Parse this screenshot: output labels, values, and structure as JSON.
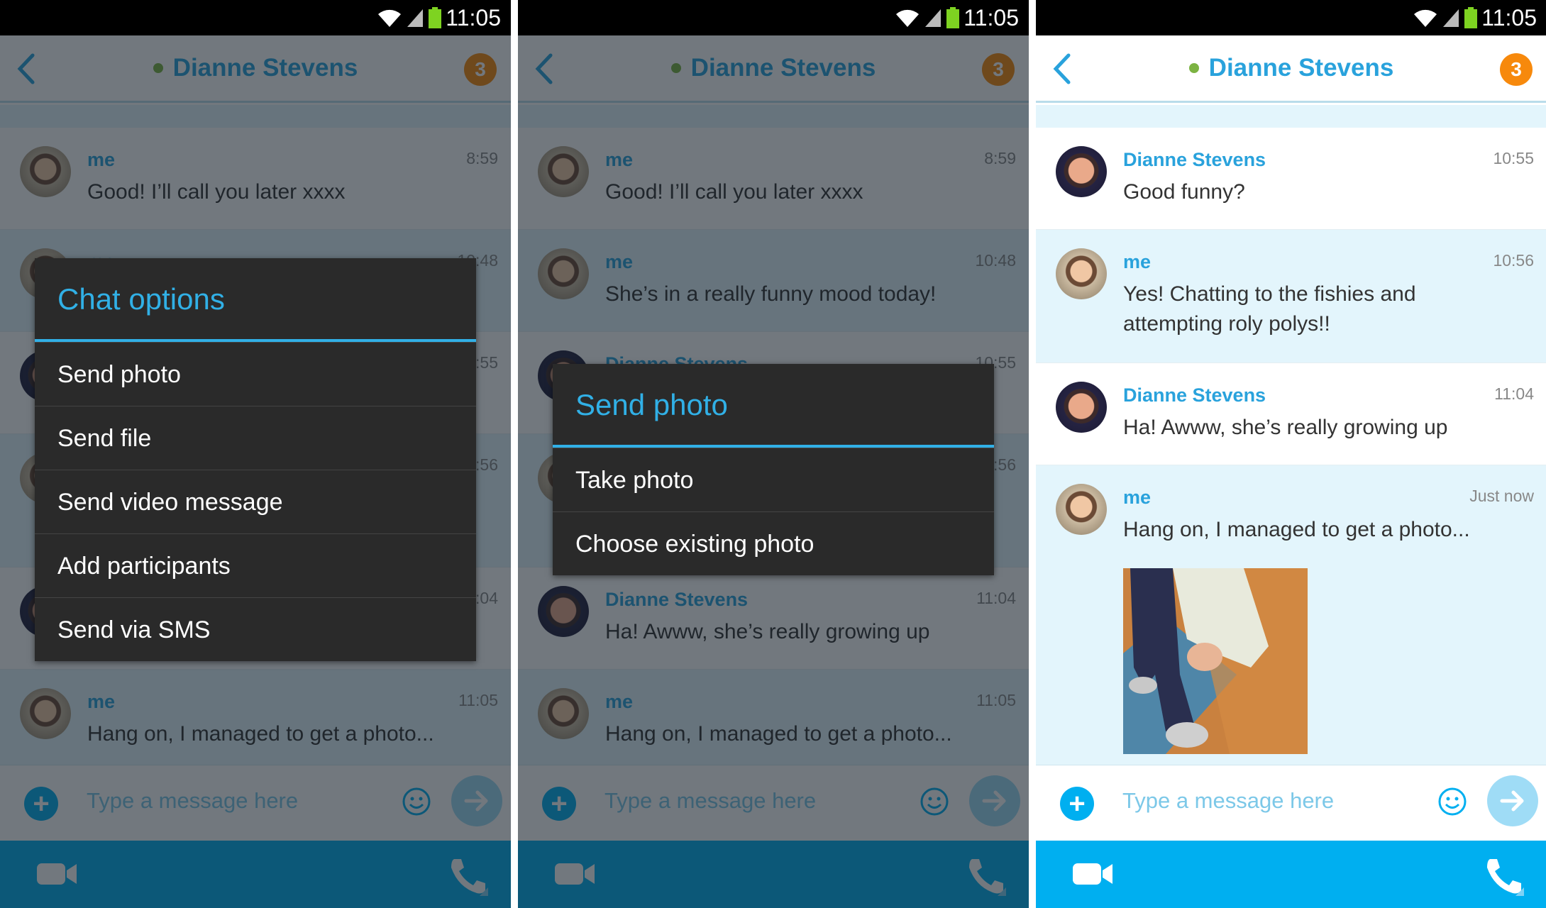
{
  "status_bar": {
    "time": "11:05",
    "icons": [
      "wifi-icon",
      "signal-icon",
      "battery-icon"
    ]
  },
  "colors": {
    "accent": "#29a2dc",
    "badge": "#f7890c",
    "presence": "#7cb342",
    "bar": "#00aff0",
    "dialog": "#2a2a2a"
  },
  "panels": [
    {
      "header": {
        "title": "Dianne Stevens",
        "badge": "3"
      },
      "dimmed": true,
      "messages": [
        {
          "sender": "me",
          "time": "8:59",
          "text": "Good! I’ll call you later xxxx",
          "avatar": "me"
        },
        {
          "sender": "me",
          "time": "10:48",
          "text": "She’s in a really funny mood today!",
          "avatar": "me",
          "alt": true
        },
        {
          "sender": "Dianne Stevens",
          "time": "10:55",
          "text": "Good funny?",
          "avatar": "dianne"
        },
        {
          "sender": "me",
          "time": "10:56",
          "text": "Yes! Chatting to the fishies and attempt-ing roly polys!!",
          "avatar": "me",
          "alt": true,
          "tall": true
        },
        {
          "sender": "Dianne Stevens",
          "time": "11:04",
          "text": "Ha! Awww, she’s really growing up",
          "avatar": "dianne"
        },
        {
          "sender": "me",
          "time": "11:05",
          "text": "Hang on, I managed to get a photo...",
          "avatar": "me",
          "alt": true
        }
      ],
      "dialog": {
        "title": "Chat options",
        "items": [
          "Send photo",
          "Send file",
          "Send video message",
          "Add participants",
          "Send via SMS"
        ]
      },
      "input": {
        "placeholder": "Type a message here"
      }
    },
    {
      "header": {
        "title": "Dianne Stevens",
        "badge": "3"
      },
      "dimmed": true,
      "messages": [
        {
          "sender": "me",
          "time": "8:59",
          "text": "Good! I’ll call you later xxxx",
          "avatar": "me"
        },
        {
          "sender": "me",
          "time": "10:48",
          "text": "She’s in a really funny mood today!",
          "avatar": "me",
          "alt": true
        },
        {
          "sender": "Dianne Stevens",
          "time": "10:55",
          "text": "Good funny?",
          "avatar": "dianne"
        },
        {
          "sender": "me",
          "time": "10:56",
          "text": "Yes! Chatting to the fishies and attempt-ing roly polys!!",
          "avatar": "me",
          "alt": true,
          "tall": true
        },
        {
          "sender": "Dianne Stevens",
          "time": "11:04",
          "text": "Ha! Awww, she’s really growing up",
          "avatar": "dianne"
        },
        {
          "sender": "me",
          "time": "11:05",
          "text": "Hang on, I managed to get a photo...",
          "avatar": "me",
          "alt": true
        }
      ],
      "dialog": {
        "title": "Send photo",
        "items": [
          "Take photo",
          "Choose existing photo"
        ]
      },
      "input": {
        "placeholder": "Type a message here"
      }
    },
    {
      "header": {
        "title": "Dianne Stevens",
        "badge": "3"
      },
      "dimmed": false,
      "messages": [
        {
          "sender": "Dianne Stevens",
          "time": "10:55",
          "text": "Good funny?",
          "avatar": "dianne"
        },
        {
          "sender": "me",
          "time": "10:56",
          "text": "Yes! Chatting to the fishies and attempting roly polys!!",
          "avatar": "me",
          "alt": true,
          "tall": true
        },
        {
          "sender": "Dianne Stevens",
          "time": "11:04",
          "text": "Ha! Awww, she’s really growing up",
          "avatar": "dianne"
        },
        {
          "sender": "me",
          "time": "Just now",
          "text": "Hang on, I managed to get a photo...",
          "avatar": "me",
          "alt": true,
          "photo": true
        }
      ],
      "input": {
        "placeholder": "Type a message here"
      }
    }
  ]
}
